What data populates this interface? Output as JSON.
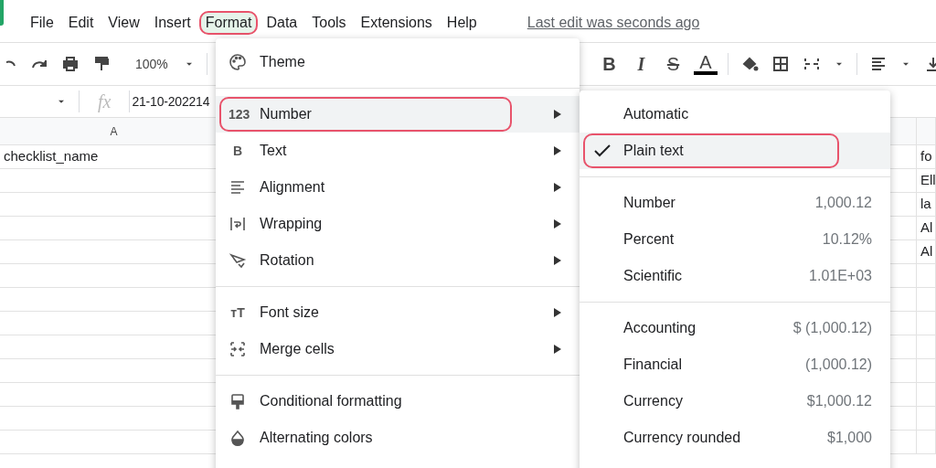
{
  "menu_bar": {
    "items": [
      {
        "label": "File",
        "selected": false
      },
      {
        "label": "Edit",
        "selected": false
      },
      {
        "label": "View",
        "selected": false
      },
      {
        "label": "Insert",
        "selected": false
      },
      {
        "label": "Format",
        "selected": true
      },
      {
        "label": "Data",
        "selected": false
      },
      {
        "label": "Tools",
        "selected": false
      },
      {
        "label": "Extensions",
        "selected": false
      },
      {
        "label": "Help",
        "selected": false
      }
    ],
    "last_edit": "Last edit was seconds ago"
  },
  "toolbar": {
    "zoom": "100%",
    "format_buttons": [
      "B",
      "I",
      "S",
      "A"
    ]
  },
  "formula_bar": {
    "fx_label": "fx",
    "value": "21-10-202214"
  },
  "grid": {
    "column_header": "A",
    "rows": [
      {
        "column_a": "checklist_name",
        "column_3": "fo"
      },
      {
        "column_3": "Ell"
      },
      {
        "column_3": "la"
      },
      {
        "column_3": "Al"
      },
      {
        "column_3": "Al"
      }
    ]
  },
  "format_menu": {
    "groups": [
      [
        {
          "label": "Theme",
          "has_submenu": false,
          "selected": false
        }
      ],
      [
        {
          "label": "Number",
          "glyph": "123",
          "has_submenu": true,
          "selected": true
        },
        {
          "label": "Text",
          "glyph": "B",
          "has_submenu": true,
          "selected": false
        },
        {
          "label": "Alignment",
          "has_submenu": true,
          "selected": false
        },
        {
          "label": "Wrapping",
          "has_submenu": true,
          "selected": false
        },
        {
          "label": "Rotation",
          "has_submenu": true,
          "selected": false
        }
      ],
      [
        {
          "label": "Font size",
          "glyph": "тT",
          "has_submenu": true,
          "selected": false
        },
        {
          "label": "Merge cells",
          "has_submenu": true,
          "selected": false
        }
      ],
      [
        {
          "label": "Conditional formatting",
          "has_submenu": false,
          "selected": false
        },
        {
          "label": "Alternating colors",
          "has_submenu": false,
          "selected": false
        }
      ]
    ]
  },
  "number_submenu": {
    "groups": [
      [
        {
          "label": "Automatic",
          "checked": false,
          "selected": false
        },
        {
          "label": "Plain text",
          "checked": true,
          "selected": true
        }
      ],
      [
        {
          "label": "Number",
          "example": "1,000.12",
          "checked": false,
          "selected": false
        },
        {
          "label": "Percent",
          "example": "10.12%",
          "checked": false,
          "selected": false
        },
        {
          "label": "Scientific",
          "example": "1.01E+03",
          "checked": false,
          "selected": false
        }
      ],
      [
        {
          "label": "Accounting",
          "example": "$ (1,000.12)",
          "checked": false,
          "selected": false
        },
        {
          "label": "Financial",
          "example": "(1,000.12)",
          "checked": false,
          "selected": false
        },
        {
          "label": "Currency",
          "example": "$1,000.12",
          "checked": false,
          "selected": false
        },
        {
          "label": "Currency rounded",
          "example": "$1,000",
          "checked": false,
          "selected": false
        }
      ]
    ]
  }
}
